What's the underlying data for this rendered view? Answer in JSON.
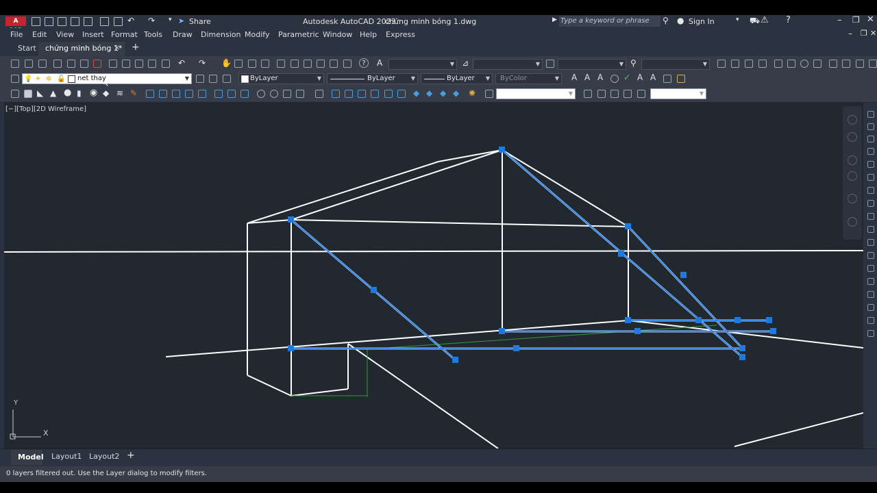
{
  "app": {
    "title": "Autodesk AutoCAD 2023",
    "file": "chứng minh bóng 1.dwg",
    "logo": "A CAD",
    "share_label": "Share",
    "search_placeholder": "Type a keyword or phrase",
    "sign_in": "Sign In"
  },
  "menu": [
    "File",
    "Edit",
    "View",
    "Insert",
    "Format",
    "Tools",
    "Draw",
    "Dimension",
    "Modify",
    "Parametric",
    "Window",
    "Help",
    "Express"
  ],
  "tabs": {
    "start": "Start",
    "active": "chứng minh bóng 1*",
    "close": "×",
    "add": "+"
  },
  "layer_bar": {
    "layer_name": "net thay",
    "color": "ByLayer",
    "linetype": "ByLayer",
    "lineweight": "ByLayer",
    "plotstyle": "ByColor"
  },
  "viewport": {
    "label": "[−][Top][2D Wireframe]",
    "ucs_y": "Y",
    "ucs_x": "X"
  },
  "layout_tabs": [
    "Model",
    "Layout1",
    "Layout2"
  ],
  "layout_add": "+",
  "status": {
    "message": "0 layers filtered out.  Use the Layer dialog to modify filters."
  },
  "colors": {
    "viewport_bg": "#212830",
    "geometry": "#ffffff",
    "grip": "#1f7ae0",
    "highlight": "#9ec6ff",
    "logo_red": "#c4262e"
  }
}
